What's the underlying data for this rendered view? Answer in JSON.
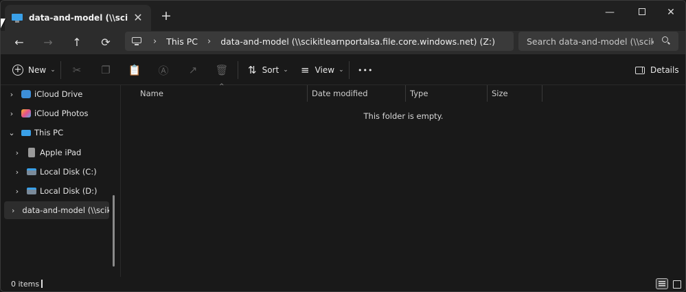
{
  "tab": {
    "title": "data-and-model (\\\\scikitlearnp",
    "close": "✕",
    "add": "+"
  },
  "window_controls": {
    "minimize": "—",
    "close": "✕"
  },
  "nav": {
    "back": "←",
    "forward": "→",
    "up": "↑",
    "refresh": "⟳"
  },
  "address": {
    "sep": "›",
    "crumbs": [
      "This PC",
      "data-and-model (\\\\scikitlearnportalsa.file.core.windows.net) (Z:)"
    ]
  },
  "search": {
    "placeholder": "Search data-and-model (\\\\scikitle"
  },
  "toolbar": {
    "new_label": "New",
    "new_glyph": "+",
    "caret": "⌄",
    "cut": "✂",
    "copy": "❐",
    "paste": "📋",
    "rename": "Ⓐ",
    "share": "↗",
    "delete": "🗑",
    "sort_glyph": "⇅",
    "sort_label": "Sort",
    "view_glyph": "≡",
    "view_label": "View",
    "more": "•••",
    "details_label": "Details"
  },
  "sidebar": {
    "chev_right": "›",
    "chev_down": "⌄",
    "items": [
      {
        "label": "iCloud Drive"
      },
      {
        "label": "iCloud Photos"
      },
      {
        "label": "This PC"
      },
      {
        "label": "Apple iPad"
      },
      {
        "label": "Local Disk (C:)"
      },
      {
        "label": "Local Disk (D:)"
      },
      {
        "label": "data-and-model (\\\\scikitlearnportalsa.file.core.windows.net) (Z:)"
      }
    ]
  },
  "columns": [
    "Name",
    "Date modified",
    "Type",
    "Size"
  ],
  "sort_indicator": "^",
  "content": {
    "empty_message": "This folder is empty."
  },
  "status": {
    "items_count": "0 items"
  },
  "colors": {
    "accent": "#3aa0e8",
    "background": "#191919",
    "chrome": "#2c2c2c"
  }
}
